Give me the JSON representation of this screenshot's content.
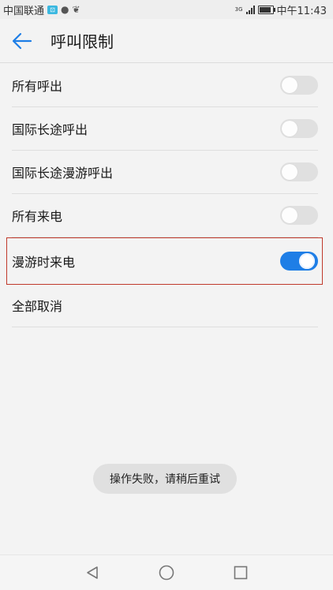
{
  "status_bar": {
    "carrier": "中国联通",
    "time": "中午11:43",
    "network_tag": "3G"
  },
  "header": {
    "title": "呼叫限制"
  },
  "settings": [
    {
      "label": "所有呼出",
      "toggle_on": false
    },
    {
      "label": "国际长途呼出",
      "toggle_on": false
    },
    {
      "label": "国际长途漫游呼出",
      "toggle_on": false
    },
    {
      "label": "所有来电",
      "toggle_on": false
    },
    {
      "label": "漫游时来电",
      "toggle_on": true
    }
  ],
  "cancel_all": "全部取消",
  "toast": "操作失败，请稍后重试",
  "colors": {
    "accent": "#1e7ee6",
    "highlight_border": "#c0392b"
  },
  "icons": {
    "back": "arrow-left-icon",
    "nav_back": "triangle-back-icon",
    "nav_home": "circle-home-icon",
    "nav_recent": "square-recents-icon"
  }
}
